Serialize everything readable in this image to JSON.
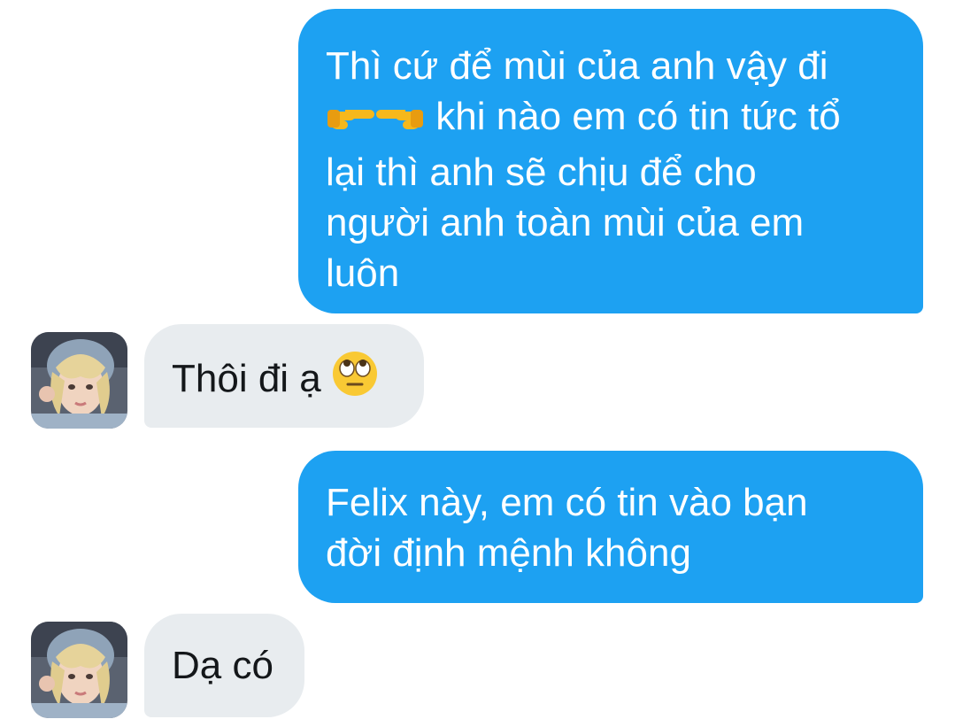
{
  "messages": [
    {
      "direction": "outgoing",
      "lines": [
        "Thì cứ để mùi của anh vậy đi",
        "khi nào em có tin tức tổ",
        "lại thì anh sẽ chịu để cho",
        "người anh toàn mùi của em",
        "luôn"
      ],
      "emoji_line_prefix": [
        "point-right-emoji",
        "point-left-emoji"
      ]
    },
    {
      "direction": "incoming",
      "text": "Thôi đi ạ",
      "emoji": "rolling-eyes-emoji"
    },
    {
      "direction": "outgoing",
      "lines": [
        "Felix này, em có tin vào bạn",
        "đời định mệnh không"
      ]
    },
    {
      "direction": "incoming",
      "text": "Dạ có"
    }
  ],
  "colors": {
    "outgoing_bubble": "#1da1f2",
    "incoming_bubble": "#e8ecef",
    "outgoing_text": "#ffffff",
    "incoming_text": "#14171a",
    "background": "#ffffff"
  },
  "avatar": {
    "icon": "contact-avatar-photo"
  }
}
